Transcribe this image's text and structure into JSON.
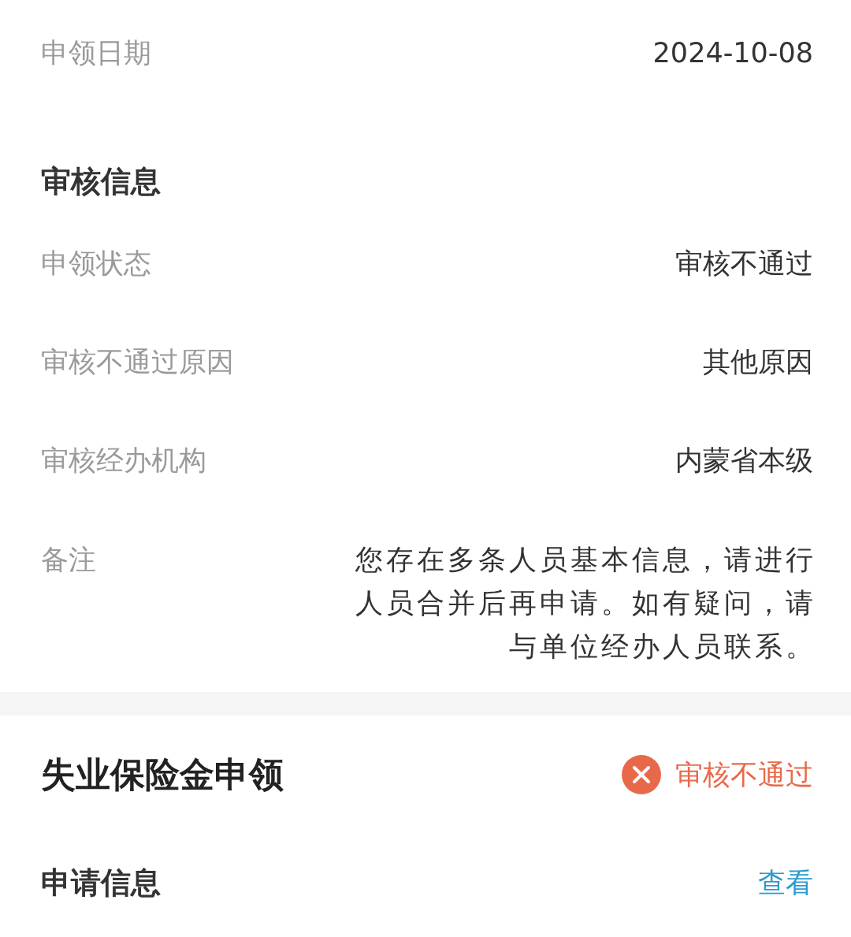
{
  "top_row": {
    "label": "申领日期",
    "value": "2024-10-08"
  },
  "review_section": {
    "title": "审核信息",
    "rows": [
      {
        "label": "申领状态",
        "value": "审核不通过"
      },
      {
        "label": "审核不通过原因",
        "value": "其他原因"
      },
      {
        "label": "审核经办机构",
        "value": "内蒙省本级"
      },
      {
        "label": "备注",
        "value": "您存在多条人员基本信息，请进行人员合并后再申请。如有疑问，请与单位经办人员联系。"
      }
    ]
  },
  "claim_card": {
    "title": "失业保险金申领",
    "status": {
      "kind": "rejected",
      "label": "审核不通过"
    },
    "section": {
      "title": "申请信息",
      "link": "查看"
    }
  }
}
